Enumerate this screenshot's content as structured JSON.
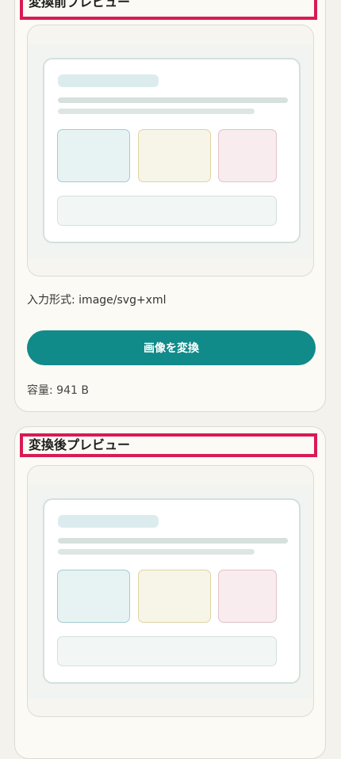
{
  "before_section": {
    "title": "変換前プレビュー",
    "input_format_label": "入力形式: image/svg+xml",
    "convert_button_label": "画像を変換",
    "file_size_label": "容量: 941 B"
  },
  "after_section": {
    "title": "変換後プレビュー"
  },
  "colors": {
    "accent": "#118a8a",
    "highlight_border": "#d81b55",
    "background": "#f3f2ec",
    "card": "#fbfaf4"
  }
}
